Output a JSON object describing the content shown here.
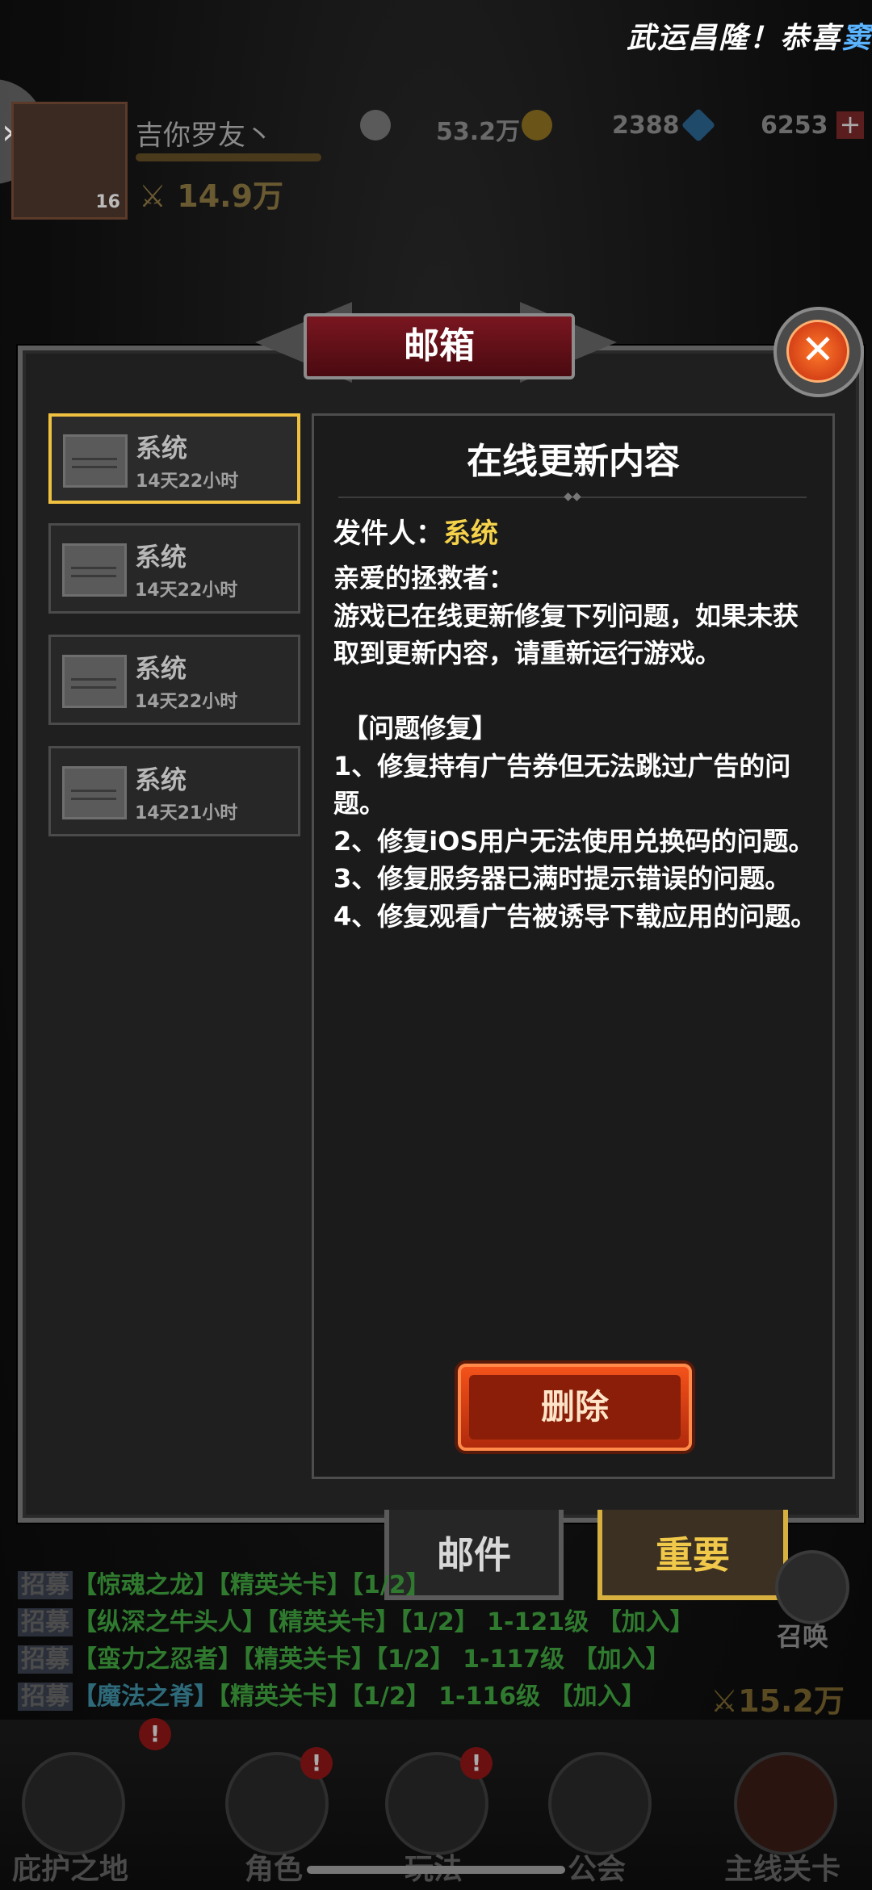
{
  "banner": {
    "text": "武运昌隆！恭喜",
    "accent": "窦"
  },
  "player": {
    "name": "吉你罗友丶",
    "level": "16",
    "power": "14.9万"
  },
  "currencies": [
    {
      "name": "silver-coin-icon",
      "value": "53.2万"
    },
    {
      "name": "gold-coin-icon",
      "value": "2388"
    },
    {
      "name": "diamond-icon",
      "value": "6253"
    }
  ],
  "dialog": {
    "title": "邮箱",
    "close_symbol": "✕",
    "mails": [
      {
        "sender": "系统",
        "time": "14天22小时"
      },
      {
        "sender": "系统",
        "time": "14天22小时"
      },
      {
        "sender": "系统",
        "time": "14天22小时"
      },
      {
        "sender": "系统",
        "time": "14天21小时"
      }
    ],
    "detail": {
      "title": "在线更新内容",
      "from_label": "发件人：",
      "from_name": "系统",
      "body": "亲爱的拯救者：\n游戏已在线更新修复下列问题，如果未获取到更新内容，请重新运行游戏。\n\n 【问题修复】\n1、修复持有广告券但无法跳过广告的问题。\n2、修复iOS用户无法使用兑换码的问题。\n3、修复服务器已满时提示错误的问题。\n4、修复观看广告被诱导下载应用的问题。",
      "delete_label": "删除"
    },
    "tabs": {
      "mail": "邮件",
      "important": "重要"
    }
  },
  "chat": [
    {
      "tag": "招募",
      "a": "【惊魂之龙】",
      "b": "【精英关卡】【1/2】",
      "c": "",
      "d": ""
    },
    {
      "tag": "招募",
      "a": "【纵深之牛头人】",
      "b": "【精英关卡】【1/2】",
      "c": "1-121级",
      "d": "【加入】"
    },
    {
      "tag": "招募",
      "a": "【蛮力之忍者】",
      "b": "【精英关卡】【1/2】",
      "c": "1-117级",
      "d": "【加入】"
    },
    {
      "tag": "招募",
      "a": "【魔法之脊】",
      "b": "【精英关卡】【1/2】",
      "c": "1-116级",
      "d": "【加入】"
    }
  ],
  "summon_label": "召唤",
  "team_power": "15.2万",
  "bottom_nav": [
    {
      "label": "庇护之地",
      "badge": "!"
    },
    {
      "label": "角色",
      "badge": "!"
    },
    {
      "label": "玩法",
      "badge": "!"
    },
    {
      "label": "公会",
      "badge": ""
    },
    {
      "label": "主线关卡",
      "badge": ""
    }
  ]
}
